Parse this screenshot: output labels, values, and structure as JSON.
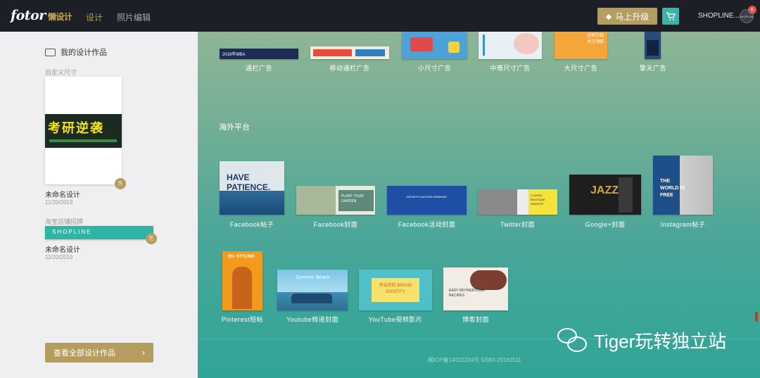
{
  "app": {
    "logo": "fotor",
    "logo_sub": "懒设计",
    "nav": [
      "设计",
      "照片编辑"
    ],
    "upgrade_label": "马上升级",
    "username": "SHOPLINE...",
    "notification_count": "6",
    "avatar_text": "SHOPLINE",
    "colors": {
      "accent": "#b59d5f",
      "teal": "#3fb2a8",
      "topbar": "#1d1f26"
    }
  },
  "sidebar": {
    "title": "我的设计作品",
    "groups": [
      {
        "label": "自定义尺寸",
        "name": "未命名设计",
        "date": "11/20/2019",
        "thumb_text": "考研逆袭"
      },
      {
        "label": "淘宝店铺招牌",
        "name": "未命名设计",
        "date": "11/20/2019",
        "thumb_text": "SHOPLINE"
      }
    ],
    "view_all_label": "查看全部设计作品",
    "icons": {
      "copy": "copy-icon",
      "chevron": "chevron-right-icon"
    }
  },
  "main": {
    "row1": [
      {
        "label": "通栏广告",
        "thumb_text": "2018年MBA"
      },
      {
        "label": "移动通栏广告"
      },
      {
        "label": "小尺寸广告"
      },
      {
        "label": "中等尺寸广告"
      },
      {
        "label": "大尺寸广告",
        "thumb_text": "全新升级 关注领取"
      },
      {
        "label": "擎天广告"
      }
    ],
    "section_title": "海外平台",
    "row2": [
      {
        "label": "Facebook帖子",
        "thumb_text": "HAVE PATIENCE."
      },
      {
        "label": "Facebook封面",
        "thumb_text": "PLANT YOUR GARDEN"
      },
      {
        "label": "Facebook活动封面",
        "thumb_text": "GROWTH HACKING WEBINAR"
      },
      {
        "label": "Twitter封面",
        "thumb_text": "CLASSIC BOUTIQUE JEWELRY"
      },
      {
        "label": "Google+封面",
        "thumb_text": "JAZZ"
      },
      {
        "label": "Instagram帖子",
        "thumb_text": "THE WORLD IS FREE"
      }
    ],
    "row3": [
      {
        "label": "Pinterest短帖",
        "thumb_text": "20+ STYLING"
      },
      {
        "label": "Youtube频道封面",
        "thumb_text": "Summer Beach"
      },
      {
        "label": "YouTube视频影片",
        "thumb_text": "开启你的 BRAND IDENTITY"
      },
      {
        "label": "博客封面",
        "thumb_text": "EASY MOTHER'S DAY RECIPES"
      }
    ],
    "icp": "闽ICP备14022224号-5/083-20160111"
  },
  "watermark": "Tiger玩转独立站"
}
